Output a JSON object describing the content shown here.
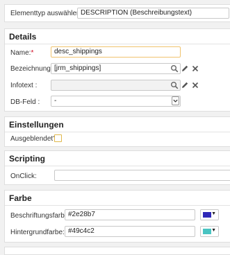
{
  "top": {
    "element_type_label": "Elementtyp auswählen:",
    "element_type_value": "DESCRIPTION (Beschreibungstext)"
  },
  "details": {
    "title": "Details",
    "name_label": "Name:",
    "name_required": "*",
    "name_value": "desc_shippings",
    "designation_label": "Bezeichnung:",
    "designation_value": "[jrm_shippings]",
    "infotext_label": "Infotext :",
    "infotext_value": "",
    "dbfield_label": "DB-Feld :",
    "dbfield_value": "-"
  },
  "settings": {
    "title": "Einstellungen",
    "hidden_label": "Ausgeblendet?",
    "hidden_checked": false
  },
  "scripting": {
    "title": "Scripting",
    "onclick_label": "OnClick:",
    "onclick_value": ""
  },
  "color": {
    "title": "Farbe",
    "label_color_label": "Beschriftungsfarbe:",
    "label_color_value": "#2e28b7",
    "bg_color_label": "Hintergrundfarbe:",
    "bg_color_value": "#49c4c2"
  },
  "icons": {
    "search": "search-icon",
    "edit": "pencil-icon",
    "clear": "close-icon",
    "dropdown": "chevron-down-icon"
  }
}
